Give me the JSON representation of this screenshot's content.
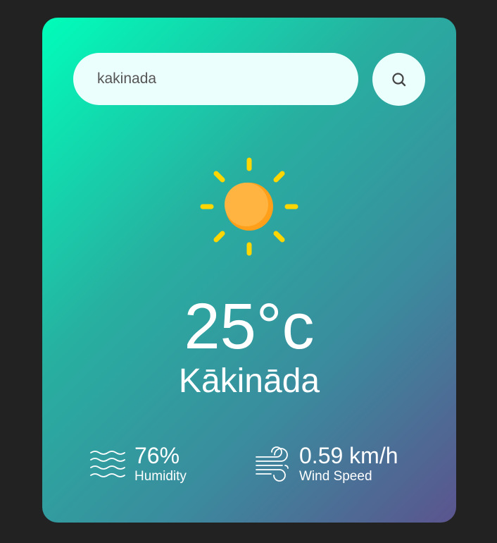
{
  "search": {
    "value": "kakinada",
    "placeholder": "",
    "button_icon": "search-icon"
  },
  "weather": {
    "icon": "sun-icon",
    "temperature": "25°c",
    "city": "Kākināda"
  },
  "details": {
    "humidity": {
      "icon": "humidity-waves-icon",
      "value": "76%",
      "label": "Humidity"
    },
    "wind": {
      "icon": "wind-icon",
      "value": "0.59 km/h",
      "label": "Wind Speed"
    }
  },
  "colors": {
    "background": "#222222",
    "gradient_start": "#00feba",
    "gradient_end": "#5b548e",
    "search_bg": "#ebfffc",
    "sun_body": "#ffad33",
    "sun_rays": "#ffd600"
  }
}
